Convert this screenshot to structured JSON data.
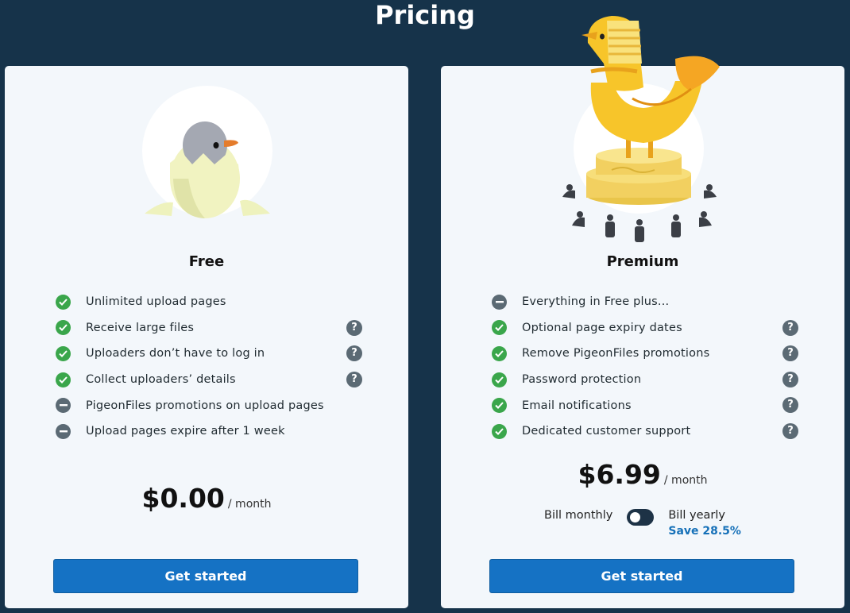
{
  "page": {
    "title": "Pricing"
  },
  "colors": {
    "background": "#16334a",
    "card": "#f3f7fb",
    "check": "#3aa64b",
    "neutral": "#5b6a74",
    "primary": "#1572c4",
    "accent_text": "#1570b8"
  },
  "plans": [
    {
      "name": "Free",
      "illustration": "hatching-pigeon-egg",
      "features": [
        {
          "label": "Unlimited upload pages",
          "status": "check-icon",
          "help": false
        },
        {
          "label": "Receive large files",
          "status": "check-icon",
          "help": true
        },
        {
          "label": "Uploaders don’t have to log in",
          "status": "check-icon",
          "help": true
        },
        {
          "label": "Collect uploaders’ details",
          "status": "check-icon",
          "help": true
        },
        {
          "label": "PigeonFiles promotions on upload pages",
          "status": "minus-icon",
          "help": false
        },
        {
          "label": "Upload pages expire after 1 week",
          "status": "minus-icon",
          "help": false
        }
      ],
      "price": "$0.00",
      "period": "/ month",
      "cta": "Get started"
    },
    {
      "name": "Premium",
      "illustration": "golden-pharaoh-pigeon-on-pedestal",
      "features": [
        {
          "label": "Everything in Free plus...",
          "status": "minus-icon",
          "help": false
        },
        {
          "label": "Optional page expiry dates",
          "status": "check-icon",
          "help": true
        },
        {
          "label": "Remove PigeonFiles promotions",
          "status": "check-icon",
          "help": true
        },
        {
          "label": "Password protection",
          "status": "check-icon",
          "help": true
        },
        {
          "label": "Email notifications",
          "status": "check-icon",
          "help": true
        },
        {
          "label": "Dedicated customer support",
          "status": "check-icon",
          "help": true
        }
      ],
      "price": "$6.99",
      "period": "/ month",
      "billing": {
        "monthly": "Bill monthly",
        "yearly": "Bill yearly",
        "save": "Save 28.5%",
        "selected": "monthly"
      },
      "cta": "Get started"
    }
  ],
  "help_glyph": "?"
}
